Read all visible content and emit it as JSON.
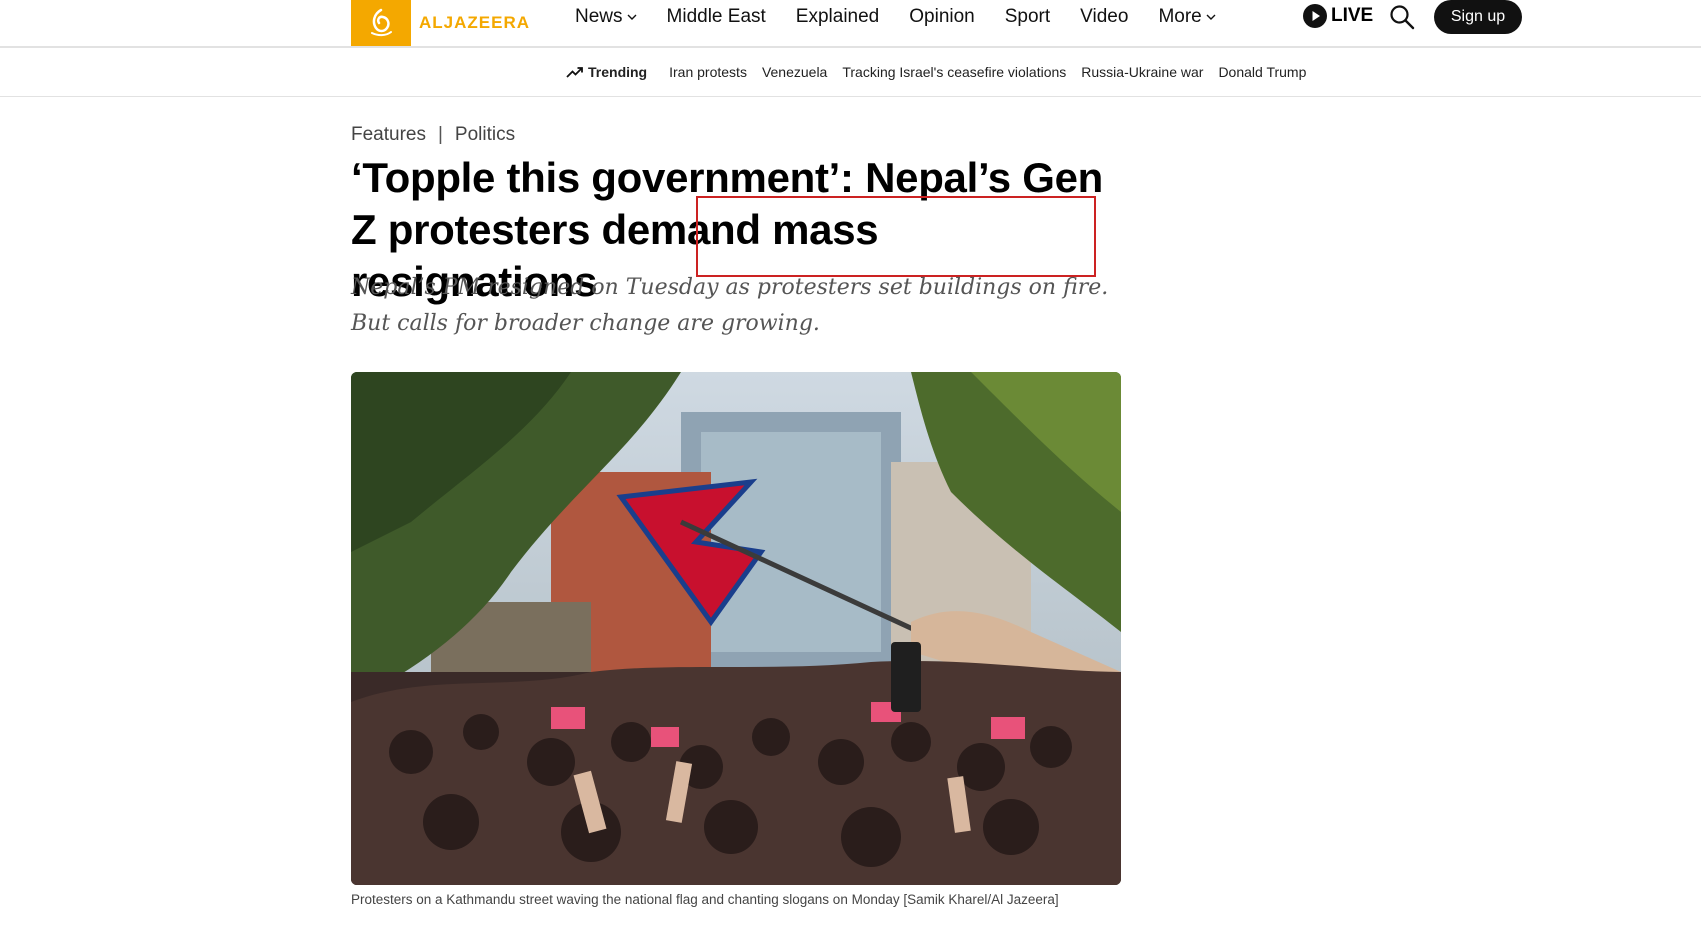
{
  "header": {
    "logo_text": "ALJAZEERA",
    "nav": [
      {
        "label": "News",
        "dropdown": true
      },
      {
        "label": "Middle East",
        "dropdown": false
      },
      {
        "label": "Explained",
        "dropdown": false
      },
      {
        "label": "Opinion",
        "dropdown": false
      },
      {
        "label": "Sport",
        "dropdown": false
      },
      {
        "label": "Video",
        "dropdown": false
      },
      {
        "label": "More",
        "dropdown": true
      }
    ],
    "live_label": "LIVE",
    "signup_label": "Sign up",
    "brand_color": "#f4a800"
  },
  "trending": {
    "label": "Trending",
    "items": [
      "Iran protests",
      "Venezuela",
      "Tracking Israel's ceasefire violations",
      "Russia-Ukraine war",
      "Donald Trump"
    ]
  },
  "article": {
    "breadcrumb": [
      "Features",
      "Politics"
    ],
    "breadcrumb_sep": "|",
    "headline": "‘Topple this government’: Nepal’s Gen Z protesters demand mass resignations",
    "standfirst": "Nepal’s PM resigned on Tuesday as protesters set buildings on fire. But calls for broader change are growing.",
    "image_caption": "Protesters on a Kathmandu street waving the national flag and chanting slogans on Monday [Samik Kharel/Al Jazeera]",
    "highlight_color": "#cc2222"
  }
}
